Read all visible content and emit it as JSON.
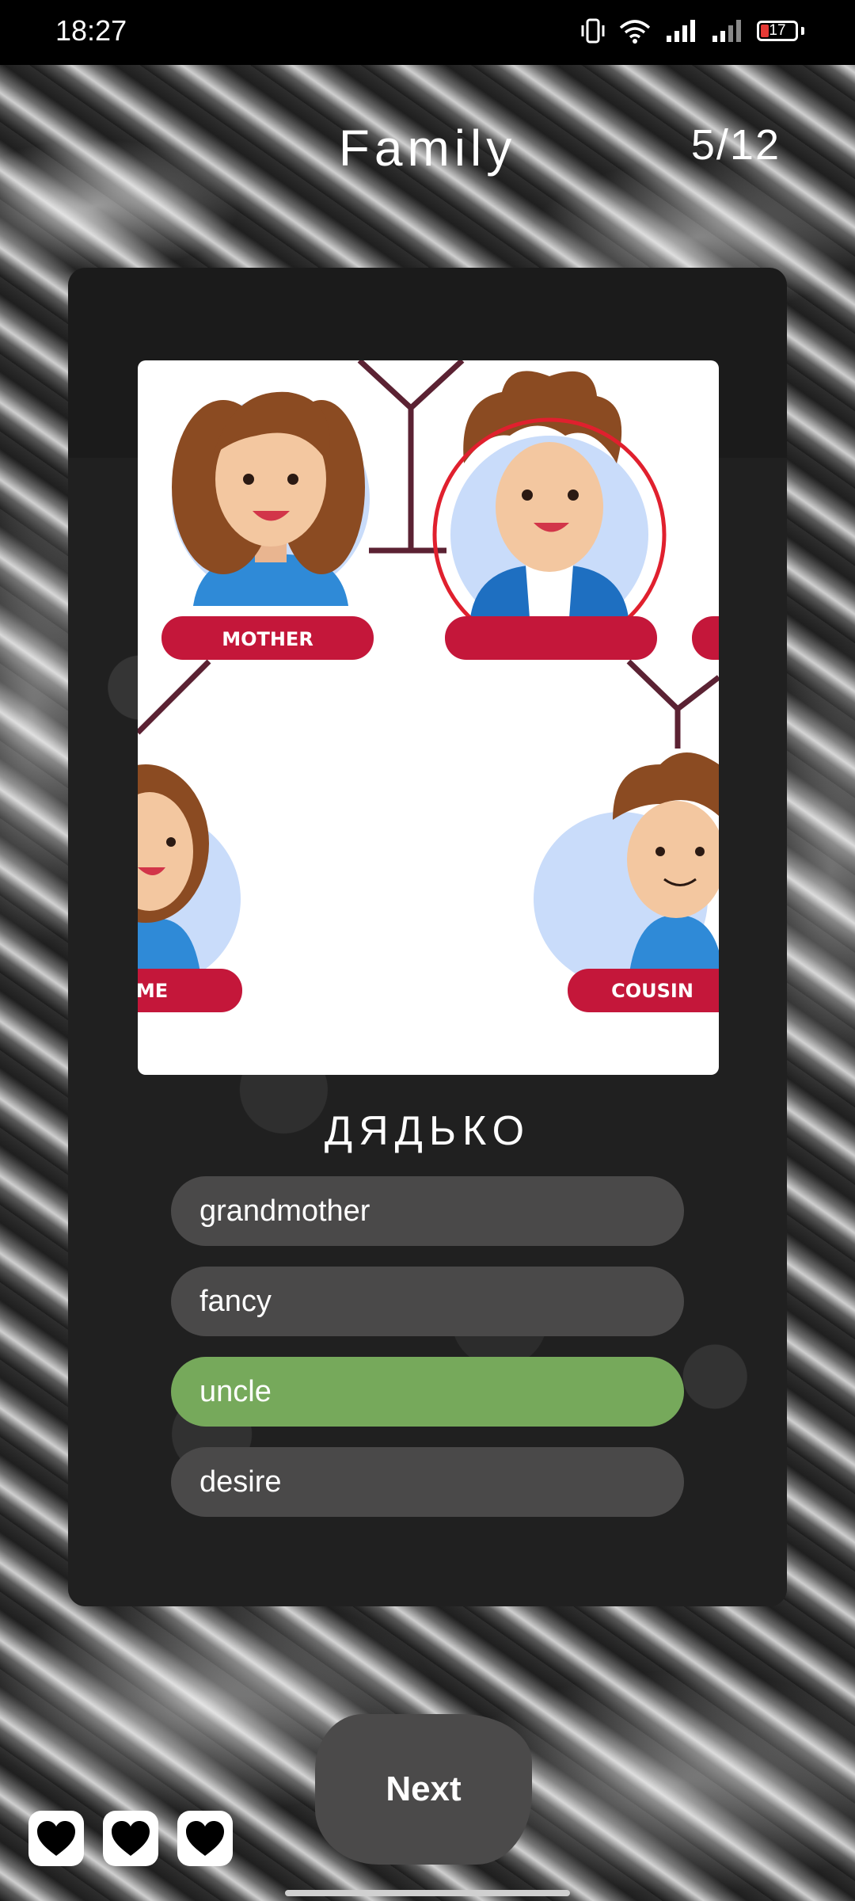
{
  "status_bar": {
    "time": "18:27",
    "battery": "17",
    "icons": [
      "vibrate-icon",
      "wifi-icon",
      "signal-icon",
      "signal-icon-2",
      "battery-icon"
    ]
  },
  "header": {
    "title": "Family",
    "counter": "5/12"
  },
  "quiz": {
    "word": "ДЯДЬКО",
    "image": {
      "labels": {
        "mother": "MOTHER",
        "partial_left": "ME",
        "cousin": "COUSIN"
      }
    },
    "options": [
      {
        "label": "grandmother",
        "state": "default"
      },
      {
        "label": "fancy",
        "state": "default"
      },
      {
        "label": "uncle",
        "state": "correct"
      },
      {
        "label": "desire",
        "state": "default"
      }
    ]
  },
  "footer": {
    "next_label": "Next",
    "lives": 3
  },
  "colors": {
    "option_default": "#4a4949",
    "option_correct": "#76a95b",
    "label_red": "#c4173a",
    "highlight_circle": "#e0202e"
  }
}
